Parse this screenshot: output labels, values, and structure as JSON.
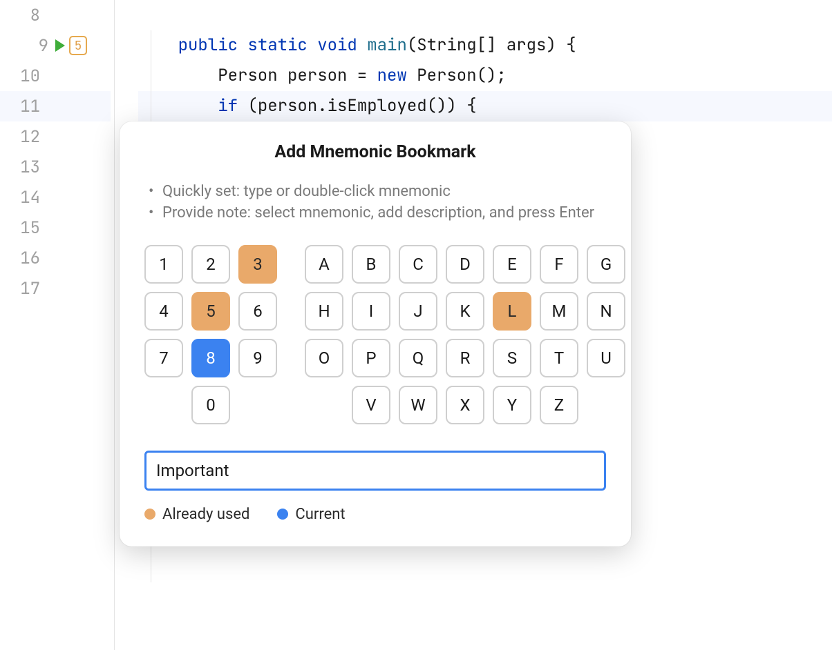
{
  "gutter": {
    "lines": [
      "8",
      "9",
      "10",
      "11",
      "12",
      "13",
      "14",
      "15",
      "16",
      "17"
    ],
    "run_line": "9",
    "bookmark_line": "9",
    "bookmark_label": "5",
    "highlighted_line": "11"
  },
  "code": {
    "lines": [
      {
        "indent": "",
        "tokens": []
      },
      {
        "indent": "    ",
        "tokens": [
          [
            "kw",
            "public"
          ],
          [
            "",
            " "
          ],
          [
            "kw",
            "static"
          ],
          [
            "",
            " "
          ],
          [
            "kw",
            "void"
          ],
          [
            "",
            " "
          ],
          [
            "fn",
            "main"
          ],
          [
            "",
            "(String[] args) {"
          ]
        ]
      },
      {
        "indent": "        ",
        "tokens": [
          [
            "",
            "Person person = "
          ],
          [
            "kw",
            "new"
          ],
          [
            "",
            " Person();"
          ]
        ]
      },
      {
        "indent": "        ",
        "tokens": [
          [
            "kw",
            "if"
          ],
          [
            "",
            " (person.isEmployed()) {"
          ]
        ]
      },
      {
        "indent": "",
        "tokens": []
      },
      {
        "indent": "",
        "tokens": []
      },
      {
        "indent": "",
        "tokens": []
      },
      {
        "indent": "",
        "tokens": []
      },
      {
        "indent": "",
        "tokens": []
      },
      {
        "indent": "",
        "tokens": []
      }
    ]
  },
  "popup": {
    "title": "Add Mnemonic Bookmark",
    "instructions": [
      "Quickly set: type or double-click mnemonic",
      "Provide note: select mnemonic, add description, and press Enter"
    ],
    "numeric_keys": [
      {
        "label": "1",
        "state": ""
      },
      {
        "label": "2",
        "state": ""
      },
      {
        "label": "3",
        "state": "used"
      },
      {
        "label": "4",
        "state": ""
      },
      {
        "label": "5",
        "state": "used"
      },
      {
        "label": "6",
        "state": ""
      },
      {
        "label": "7",
        "state": ""
      },
      {
        "label": "8",
        "state": "current"
      },
      {
        "label": "9",
        "state": ""
      },
      {
        "label": "",
        "state": "empty"
      },
      {
        "label": "0",
        "state": ""
      },
      {
        "label": "",
        "state": "empty"
      }
    ],
    "alpha_keys": [
      {
        "label": "A",
        "state": ""
      },
      {
        "label": "B",
        "state": ""
      },
      {
        "label": "C",
        "state": ""
      },
      {
        "label": "D",
        "state": ""
      },
      {
        "label": "E",
        "state": ""
      },
      {
        "label": "F",
        "state": ""
      },
      {
        "label": "G",
        "state": ""
      },
      {
        "label": "H",
        "state": ""
      },
      {
        "label": "I",
        "state": ""
      },
      {
        "label": "J",
        "state": ""
      },
      {
        "label": "K",
        "state": ""
      },
      {
        "label": "L",
        "state": "used"
      },
      {
        "label": "M",
        "state": ""
      },
      {
        "label": "N",
        "state": ""
      },
      {
        "label": "O",
        "state": ""
      },
      {
        "label": "P",
        "state": ""
      },
      {
        "label": "Q",
        "state": ""
      },
      {
        "label": "R",
        "state": ""
      },
      {
        "label": "S",
        "state": ""
      },
      {
        "label": "T",
        "state": ""
      },
      {
        "label": "U",
        "state": ""
      },
      {
        "label": "",
        "state": "empty"
      },
      {
        "label": "V",
        "state": ""
      },
      {
        "label": "W",
        "state": ""
      },
      {
        "label": "X",
        "state": ""
      },
      {
        "label": "Y",
        "state": ""
      },
      {
        "label": "Z",
        "state": ""
      },
      {
        "label": "",
        "state": "empty"
      }
    ],
    "description_value": "Important",
    "legend_used": "Already used",
    "legend_current": "Current"
  }
}
